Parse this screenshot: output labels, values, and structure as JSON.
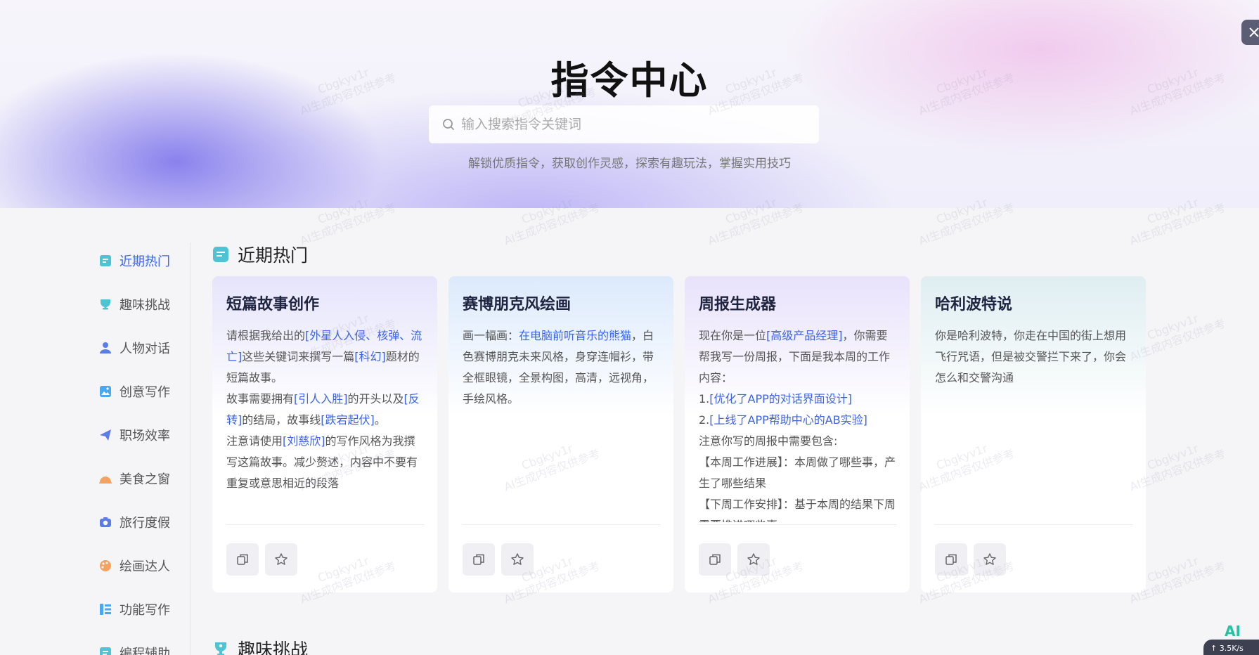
{
  "hero": {
    "title": "指令中心",
    "search_placeholder": "输入搜索指令关键词",
    "subtitle": "解锁优质指令，获取创作灵感，探索有趣玩法，掌握实用技巧"
  },
  "watermark": {
    "line1": "Cbgkyv1r",
    "line2": "AI生成内容仅供参考"
  },
  "sidebar": {
    "items": [
      {
        "label": "近期热门",
        "icon": "document-icon",
        "active": true
      },
      {
        "label": "趣味挑战",
        "icon": "trophy-icon"
      },
      {
        "label": "人物对话",
        "icon": "person-icon"
      },
      {
        "label": "创意写作",
        "icon": "image-icon"
      },
      {
        "label": "职场效率",
        "icon": "paper-plane-icon"
      },
      {
        "label": "美食之窗",
        "icon": "food-cover-icon"
      },
      {
        "label": "旅行度假",
        "icon": "camera-icon"
      },
      {
        "label": "绘画达人",
        "icon": "palette-icon"
      },
      {
        "label": "功能写作",
        "icon": "list-icon"
      },
      {
        "label": "编程辅助",
        "icon": "code-doc-icon"
      }
    ]
  },
  "sections": [
    {
      "title": "近期热门",
      "icon": "document-icon"
    },
    {
      "title": "趣味挑战",
      "icon": "trophy-icon"
    }
  ],
  "cards": [
    {
      "title": "短篇故事创作",
      "segments": [
        {
          "t": "请根据我给出的"
        },
        {
          "t": "[外星人入侵、核弹、流亡]",
          "hl": true
        },
        {
          "t": "这些关键词来撰写一篇"
        },
        {
          "t": "[科幻]",
          "hl": true
        },
        {
          "t": "题材的短篇故事。"
        },
        {
          "br": true
        },
        {
          "t": "故事需要拥有"
        },
        {
          "t": "[引人入胜]",
          "hl": true
        },
        {
          "t": "的开头以及"
        },
        {
          "t": "[反转]",
          "hl": true
        },
        {
          "t": "的结局，故事线"
        },
        {
          "t": "[跌宕起伏]",
          "hl": true
        },
        {
          "t": "。"
        },
        {
          "br": true
        },
        {
          "t": "注意请使用"
        },
        {
          "t": "[刘慈欣]",
          "hl": true
        },
        {
          "t": "的写作风格为我撰写这篇故事。减少赘述，内容中不要有重复或意思相近的段落"
        }
      ]
    },
    {
      "title": "赛博朋克风绘画",
      "segments": [
        {
          "t": "画一幅画："
        },
        {
          "t": "在电脑前听音乐的熊猫",
          "hl": true
        },
        {
          "t": "，白色赛博朋克未来风格，身穿连帽衫，带全框眼镜，全景构图，高清，远视角，手绘风格。"
        }
      ]
    },
    {
      "title": "周报生成器",
      "segments": [
        {
          "t": "现在你是一位"
        },
        {
          "t": "[高级产品经理]",
          "hl": true
        },
        {
          "t": "，你需要帮我写一份周报，下面是我本周的工作内容："
        },
        {
          "br": true
        },
        {
          "t": "1."
        },
        {
          "t": "[优化了APP的对话界面设计]",
          "hl": true
        },
        {
          "br": true
        },
        {
          "t": "2."
        },
        {
          "t": "[上线了APP帮助中心的AB实验]",
          "hl": true
        },
        {
          "br": true
        },
        {
          "t": "注意你写的周报中需要包含:"
        },
        {
          "br": true
        },
        {
          "t": "【本周工作进展】：本周做了哪些事，产生了哪些结果"
        },
        {
          "br": true
        },
        {
          "t": "【下周工作安排】：基于本周的结果下周需要推进哪些事"
        }
      ]
    },
    {
      "title": "哈利波特说",
      "segments": [
        {
          "t": "你是哈利波特，你走在中国的街上想用飞行咒语，但是被交警拦下来了，你会怎么和交警沟通"
        }
      ]
    }
  ],
  "footer": {
    "ai_badge": "AI",
    "speed": "3.5K/s"
  },
  "colors": {
    "accent": "#3b63e8",
    "title": "#111111",
    "card_title": "#1f2440"
  }
}
